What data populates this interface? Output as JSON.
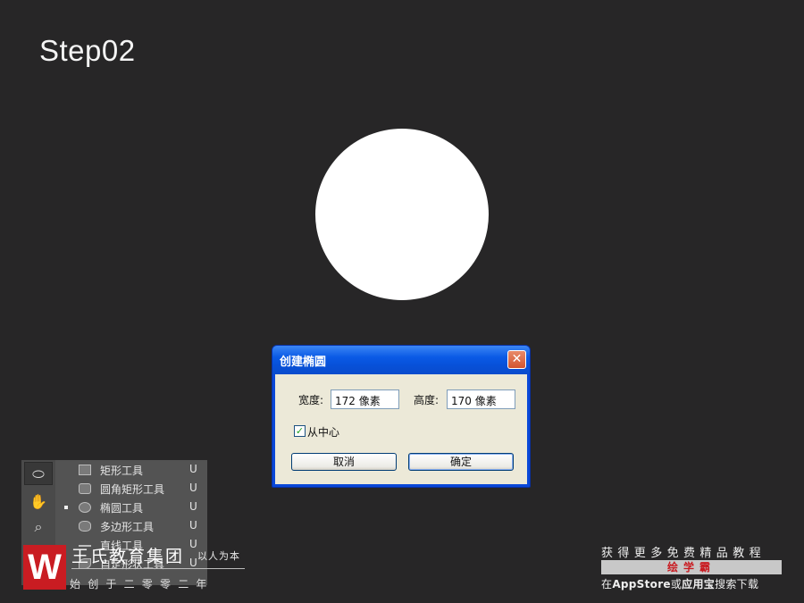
{
  "step_title": "Step02",
  "dialog": {
    "title": "创建椭圆",
    "close_glyph": "✕",
    "width_label": "宽度:",
    "width_value": "172 像素",
    "height_label": "高度:",
    "height_value": "170 像素",
    "from_center_label": "从中心",
    "from_center_checked": true,
    "check_glyph": "✓",
    "cancel_label": "取消",
    "ok_label": "确定"
  },
  "tool_flyout": {
    "items": [
      {
        "name": "矩形工具",
        "key": "U"
      },
      {
        "name": "圆角矩形工具",
        "key": "U"
      },
      {
        "name": "椭圆工具",
        "key": "U",
        "selected": true
      },
      {
        "name": "多边形工具",
        "key": "U"
      },
      {
        "name": "直线工具",
        "key": "U"
      },
      {
        "name": "自定形状工具",
        "key": "U"
      }
    ]
  },
  "brand": {
    "logo_letter": "W",
    "name": "王氏教育集团",
    "slogan": "以人为本",
    "sub": "始创于二零零二年"
  },
  "promo": {
    "top": "获得更多免费精品教程",
    "app_name": "绘学霸",
    "bottom_prefix": "在",
    "store1": "AppStore",
    "middle": "或",
    "store2": "应用宝",
    "bottom_suffix": "搜索下载"
  },
  "colors": {
    "background": "#272627",
    "dialog_title_blue": "#0a5ae6",
    "brand_red": "#c91c22"
  }
}
